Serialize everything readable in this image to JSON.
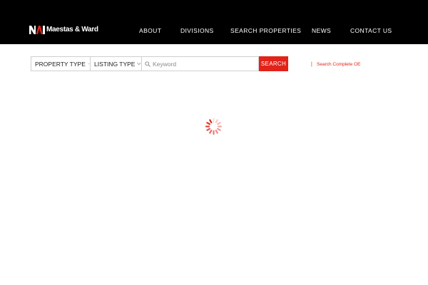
{
  "header": {
    "logo_text": "Maestas & Ward",
    "logo_icon": "mw-logo-mark",
    "nav": [
      {
        "label": "ABOUT"
      },
      {
        "label": "DIVISIONS"
      },
      {
        "label": "SEARCH PROPERTIES"
      },
      {
        "label": "NEWS"
      },
      {
        "label": "CONTACT US"
      }
    ]
  },
  "search": {
    "property_type_label": "PROPERTY TYPE",
    "listing_type_label": "LISTING TYPE",
    "keyword_placeholder": "Keyword",
    "keyword_value": "",
    "button_label": "SEARCH",
    "separator": "|",
    "complete_link": "Search Complete OE"
  },
  "loading": {
    "icon": "loading-spinner-icon"
  },
  "colors": {
    "header_bg": "#000000",
    "accent": "#e2231a",
    "border": "#cfcfcf"
  }
}
